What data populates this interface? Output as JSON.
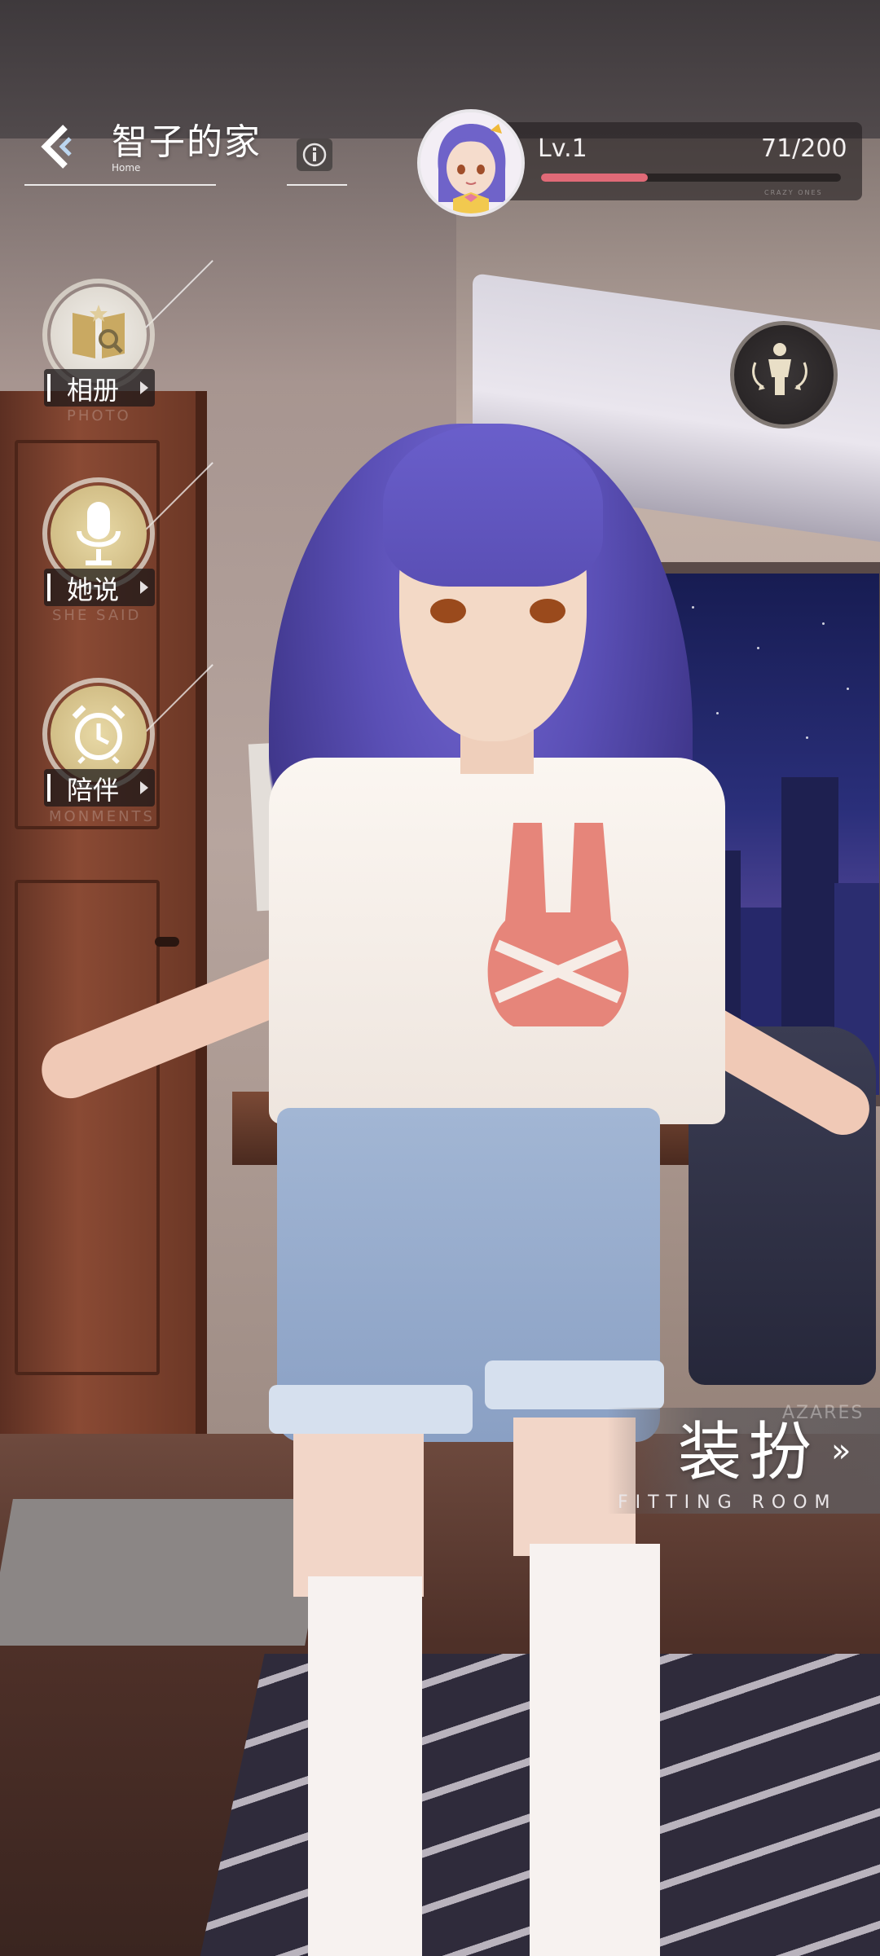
{
  "header": {
    "title": "智子的家",
    "subtitle": "Home"
  },
  "level": {
    "label": "Lv.1",
    "exp_text": "71/200",
    "exp_current": 71,
    "exp_max": 200,
    "tag": "CRAZY ONES",
    "fill_color": "#e06a77"
  },
  "side_menu": [
    {
      "label": "相册",
      "sub": "PHOTO",
      "icon": "album-icon"
    },
    {
      "label": "她说",
      "sub": "SHE SAID",
      "icon": "microphone-icon"
    },
    {
      "label": "陪伴",
      "sub": "MONMENTS",
      "icon": "alarm-clock-icon"
    }
  ],
  "fitting_room": {
    "title": "装扮",
    "subtitle": "FITTING ROOM",
    "bg_word": "AZARES",
    "chevrons": "»"
  },
  "icons": {
    "back": "chevron-left-icon",
    "info": "info-icon",
    "pose": "rotate-pose-icon"
  }
}
